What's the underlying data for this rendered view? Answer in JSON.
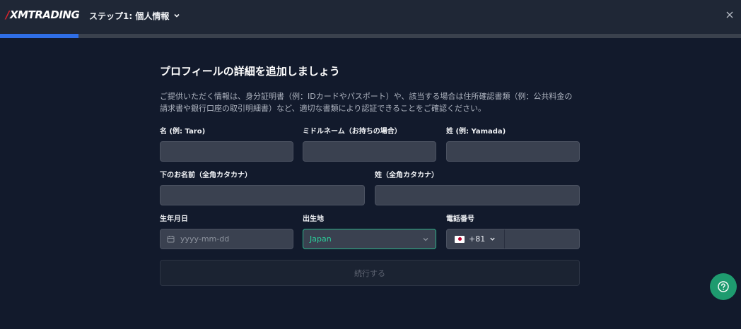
{
  "header": {
    "logo_text": "XMTRADING",
    "step_title": "ステップ1: 個人情報",
    "close_symbol": "✕"
  },
  "progress": {
    "fraction": 0.106
  },
  "form": {
    "title": "プロフィールの詳細を追加しましょう",
    "description": "ご提供いただく情報は、身分証明書（例：IDカードやパスポート）や、該当する場合は住所確認書類（例：公共料金の請求書や銀行口座の取引明細書）など、適切な書類により認証できることをご確認ください。",
    "first_name": {
      "label": "名 (例: Taro)",
      "value": ""
    },
    "middle_name": {
      "label": "ミドルネーム（お持ちの場合）",
      "value": ""
    },
    "last_name": {
      "label": "姓 (例: Yamada)",
      "value": ""
    },
    "first_name_kana": {
      "label": "下のお名前（全角カタカナ）",
      "value": ""
    },
    "last_name_kana": {
      "label": "姓（全角カタカナ）",
      "value": ""
    },
    "birth_date": {
      "label": "生年月日",
      "placeholder": "yyyy-mm-dd"
    },
    "birth_place": {
      "label": "出生地",
      "value": "Japan"
    },
    "phone": {
      "label": "電話番号",
      "country_code": "+81",
      "value": ""
    },
    "submit_label": "続行する"
  },
  "colors": {
    "accent_green": "#2bd19c",
    "progress_blue": "#2f6ee6",
    "help_button": "#1e9b6f"
  }
}
